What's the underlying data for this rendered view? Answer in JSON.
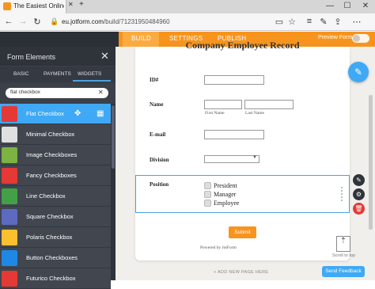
{
  "browser": {
    "tab_title": "The Easiest Online Form",
    "url_host": "eu.jotform.com",
    "url_path": "/build/71231950484960",
    "win_min": "—",
    "win_max": "☐",
    "win_close": "✕"
  },
  "topbar": {
    "tabs": [
      "BUILD",
      "SETTINGS",
      "PUBLISH"
    ],
    "preview_label": "Preview Form"
  },
  "panel": {
    "title": "Form Elements",
    "close": "✕",
    "tabs": [
      "BASIC",
      "PAYMENTS",
      "WIDGETS"
    ],
    "search_value": "flat checkbox",
    "items": [
      {
        "label": "Flat Checkbox",
        "color": "#e53935"
      },
      {
        "label": "Minimal Checkbox",
        "color": "#e0e0e0"
      },
      {
        "label": "Image Checkboxes",
        "color": "#7cb342"
      },
      {
        "label": "Fancy Checkboxes",
        "color": "#e53935"
      },
      {
        "label": "Line Checkbox",
        "color": "#43a047"
      },
      {
        "label": "Square Checkbox",
        "color": "#5c6bc0"
      },
      {
        "label": "Polaris Checkbox",
        "color": "#fbc02d"
      },
      {
        "label": "Button Checkboxes",
        "color": "#1e88e5"
      },
      {
        "label": "Futurico Checkbox",
        "color": "#e53935"
      }
    ]
  },
  "form": {
    "title": "Company Employee Record",
    "labels": {
      "id": "ID#",
      "name": "Name",
      "email": "E-mail",
      "division": "Division",
      "position": "Position"
    },
    "sublabels": {
      "first": "First Name",
      "last": "Last Name"
    },
    "position_options": [
      "President",
      "Manager",
      "Employee"
    ],
    "submit": "Submit",
    "powered": "Powered by JotForm"
  },
  "canvas": {
    "scroll_top": "Scroll to top",
    "add_page": "+ ADD NEW PAGE HERE",
    "feedback": "Send Feedback"
  },
  "colors": {
    "accent": "#f7941d",
    "blue": "#3fa9f5"
  }
}
